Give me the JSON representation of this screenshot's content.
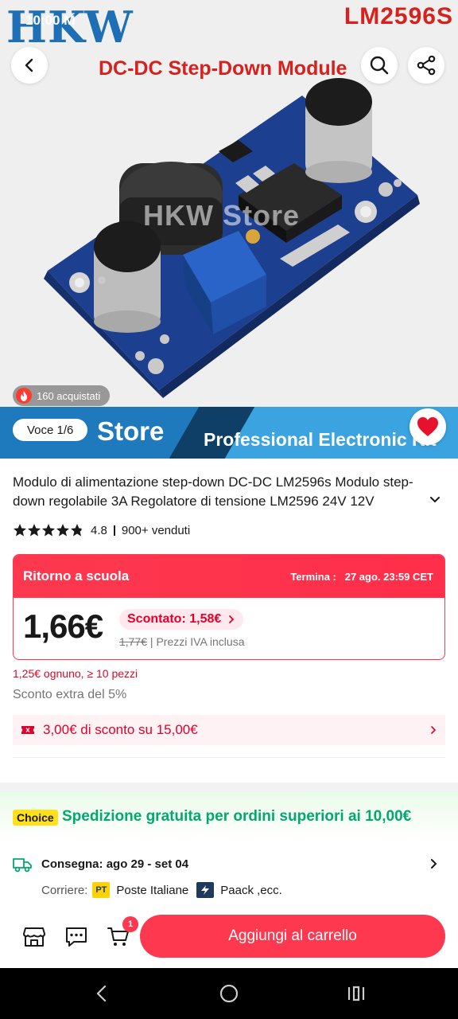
{
  "status_bar": {
    "time": "10:00 M"
  },
  "product_image": {
    "brand_logo": "HKW",
    "model_label": "LM2596S",
    "heading": "DC-DC Step-Down Module",
    "watermark": "HKW Store",
    "sold_badge": "160 acquistati",
    "image_counter": "Voce 1/6"
  },
  "top_buttons": {
    "back": "back-arrow",
    "search": "search",
    "share": "share"
  },
  "store_banner": {
    "store_word": "Store",
    "tagline": "Professional Electronic Kit"
  },
  "product": {
    "title": "Modulo di alimentazione step-down DC-DC LM2596s Modulo step-down regolabile 3A Regolatore di tensione LM2596 24V 12V",
    "rating": "4.8",
    "rating_fraction": 0.96,
    "sold": "900+ venduti"
  },
  "deal": {
    "name": "Ritorno a scuola",
    "ends_label": "Termina :",
    "ends_value": "27 ago. 23:59 CET",
    "price": "1,66€",
    "discount_label": "Scontato: 1,58€",
    "old_price": "1,77€",
    "vat_note": "Prezzi IVA inclusa",
    "accent": "#fd384f"
  },
  "bulk_price": "1,25€ ognuno, ≥ 10 pezzi",
  "extra_discount": "Sconto extra del 5%",
  "coupon": "3,00€ di sconto su 15,00€",
  "shipping": {
    "choice_badge": "Choice",
    "choice_text": "Spedizione gratuita per ordini superiori ai 10,00€",
    "delivery_label": "Consegna:",
    "delivery_dates": "ago 29 - set 04",
    "carrier_label": "Corriere:",
    "carrier_1_logo": "PT",
    "carrier_1": "Poste Italiane",
    "carrier_2": "Paack ,ecc.",
    "accent": "#01a971"
  },
  "action_bar": {
    "store_icon": "store",
    "chat_icon": "chat",
    "cart_icon": "cart",
    "cart_count": "1",
    "add_to_cart": "Aggiungi al carrello"
  },
  "nav_bar": {
    "back": "back",
    "home": "home",
    "recents": "recents"
  }
}
